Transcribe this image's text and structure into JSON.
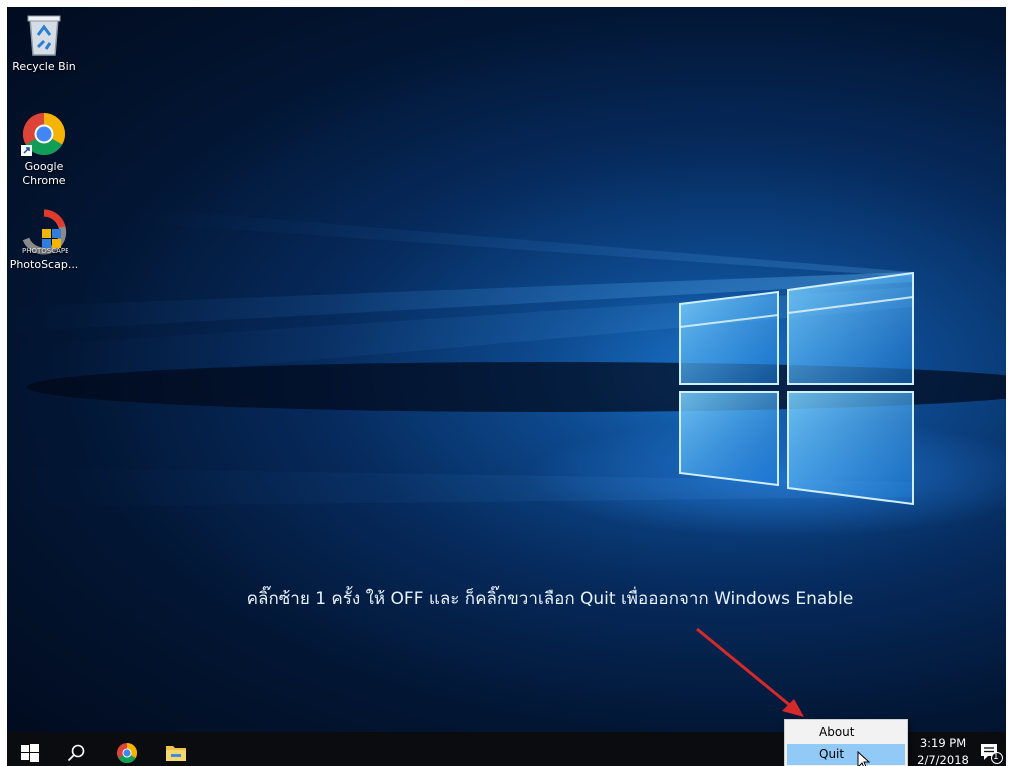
{
  "desktop": {
    "icons": [
      {
        "label": "Recycle Bin",
        "icon": "recycle-bin-icon"
      },
      {
        "label": "Google\nChrome",
        "icon": "chrome-icon"
      },
      {
        "label": "PhotoScap...",
        "icon": "photoscape-icon"
      }
    ],
    "instruction_text": "คลิ๊กซ้าย 1 ครั้ง ให้  OFF และ ก็คลิ๊กขวาเลือก Quit เพื่อออกจาก Windows Enable",
    "annotation_arrow_color": "#d42a2a"
  },
  "context_menu": {
    "items": [
      {
        "label": "About",
        "highlighted": false
      },
      {
        "label": "Quit",
        "highlighted": true
      }
    ]
  },
  "taskbar": {
    "buttons": [
      "start-icon",
      "search-icon",
      "chrome-icon",
      "file-explorer-icon"
    ],
    "clock": {
      "time": "3:19 PM",
      "date": "2/7/2018"
    },
    "notification_count": "1"
  },
  "colors": {
    "taskbar_bg": "#0b0c10",
    "menu_highlight": "#91c9f7",
    "wallpaper_glow": "#1a73c9"
  }
}
